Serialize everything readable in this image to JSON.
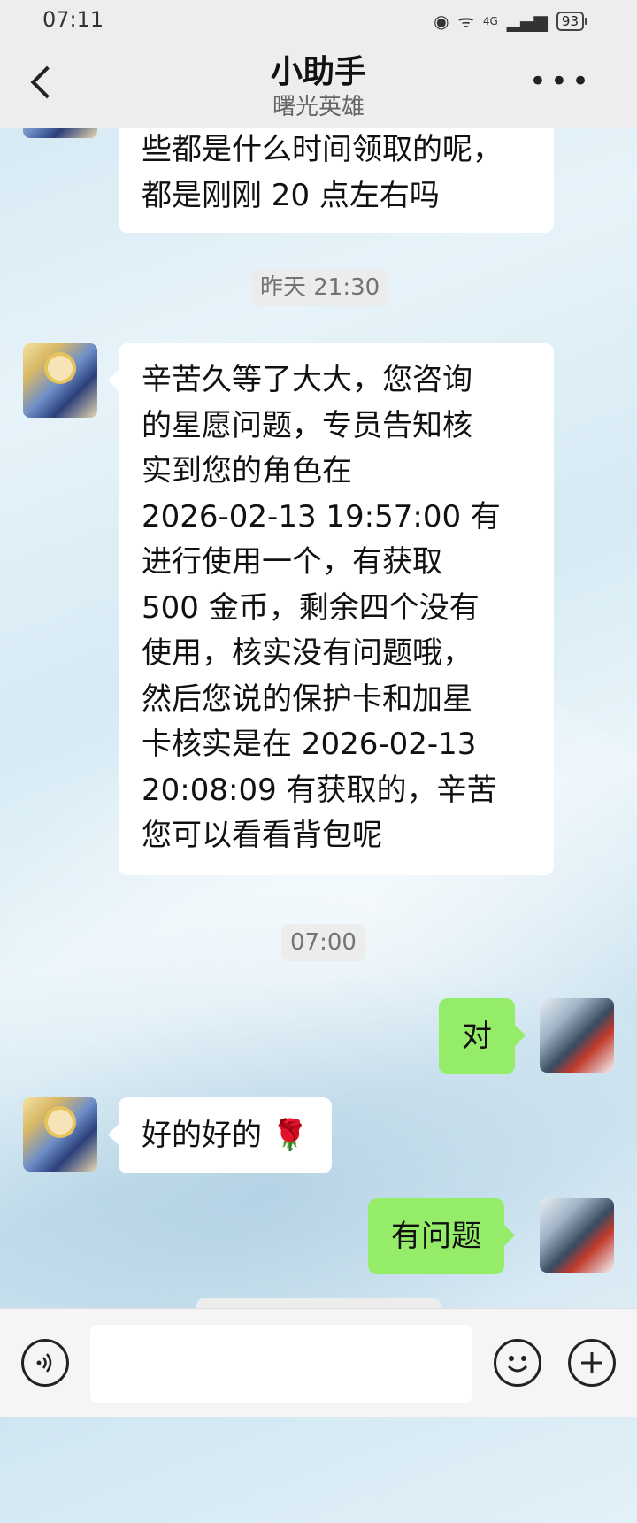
{
  "status_bar": {
    "time": "07:11",
    "network": "4G",
    "battery": "93"
  },
  "header": {
    "title": "小助手",
    "subtitle": "曙光英雄"
  },
  "messages": [
    {
      "sender": "assistant",
      "text_lines": [
        "些都是什么时间领取的呢，",
        "都是刚刚 20 点左右吗"
      ]
    },
    {
      "type": "timestamp",
      "text": "昨天 21:30"
    },
    {
      "sender": "assistant",
      "text_lines": [
        "辛苦久等了大大，您咨询",
        "的星愿问题，专员告知核",
        "实到您的角色在",
        "2026-02-13 19:57:00 有",
        "进行使用一个，有获取",
        "500 金币，剩余四个没有",
        "使用，核实没有问题哦，",
        "然后您说的保护卡和加星",
        "卡核实是在 2026-02-13",
        "20:08:09 有获取的，辛苦",
        "您可以看看背包呢"
      ]
    },
    {
      "type": "timestamp",
      "text": "07:00"
    },
    {
      "sender": "user",
      "text": "对"
    },
    {
      "sender": "assistant",
      "text": "好的好的 🌹"
    },
    {
      "sender": "user",
      "text": "有问题"
    }
  ],
  "icons": {
    "back": "chevron-left-icon",
    "more": "more-dots-icon",
    "voice": "voice-icon",
    "emoji": "emoji-icon",
    "plus": "plus-icon"
  },
  "colors": {
    "self_bubble": "#95ec69",
    "other_bubble": "#ffffff",
    "header_bg": "#ededed"
  }
}
